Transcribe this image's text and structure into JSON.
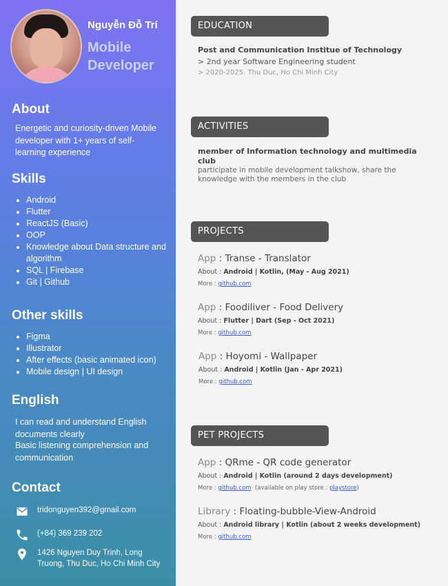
{
  "profile": {
    "name": "Nguyễn Đỗ Trí",
    "role": "Mobile Developer"
  },
  "about": {
    "heading": "About",
    "text": "Energetic and curiosity-driven Mobile developer with 1+ years of self-learning experience"
  },
  "skills": {
    "heading": "Skills",
    "items": [
      "Android",
      "Flutter",
      "ReactJS (Basic)",
      "OOP",
      "Knowledge about Data structure and algorithm",
      "SQL | Firebase",
      "Git | Github"
    ]
  },
  "other_skills": {
    "heading": "Other skills",
    "items": [
      "Figma",
      "Illustrator",
      "After effects (basic animated icon)",
      "Mobile design | UI design"
    ]
  },
  "english": {
    "heading": "English",
    "line1": "I can read and understand English documents clearly",
    "line2": "Basic listening comprehension and communication"
  },
  "contact": {
    "heading": "Contact",
    "email": "tridonguyen392@gmail.com",
    "phone": "(+84) 369 239 202",
    "address": "1426 Nguyen Duy Trinh, Long Truong, Thu Duc, Ho Chi Minh City"
  },
  "education": {
    "heading": "EDUCATION",
    "school": "Post and Communication Institue of Technology",
    "line1": "> 2nd year Software Engineering student",
    "line2": "> 2020-2025. Thu Duc, Ho Chi Minh City"
  },
  "activities": {
    "heading": "ACTIVITIES",
    "title": "member of Information technology and multimedia club",
    "desc": "participate in mobile development talkshow, share the knowledge with the members in the club"
  },
  "projects": {
    "heading": "PROJECTS",
    "items": [
      {
        "kind": "App",
        "sep": " : ",
        "name": "Transe - Translator",
        "about_label": "About : ",
        "about": "Android | Kotlin, (May - Aug 2021)",
        "more_label": "More : ",
        "link": "github.com"
      },
      {
        "kind": "App",
        "sep": " : ",
        "name": "Foodiliver - Food Delivery",
        "about_label": "About : ",
        "about": "Flutter | Dart (Sep - Oct 2021)",
        "more_label": "More : ",
        "link": "github.com"
      },
      {
        "kind": "App",
        "sep": " : ",
        "name": "Hoyomi - Wallpaper",
        "about_label": "About : ",
        "about": "Android | Kotlin (Jan - Apr 2021)",
        "more_label": "More : ",
        "link": "github.com"
      }
    ]
  },
  "pet_projects": {
    "heading": "PET PROJECTS",
    "items": [
      {
        "kind": "App",
        "sep": " : ",
        "name": "QRme - QR code generator",
        "about_label": "About : ",
        "about": "Android | Kotlin (around 2 days development)",
        "more_label": "More : ",
        "link": "github.com",
        "extra_pre": "(available on play store : ",
        "extra_link": "playstore",
        "extra_post": ")"
      },
      {
        "kind": "Library",
        "sep": " : ",
        "name": "Floating-bubble-View-Android",
        "about_label": "About : ",
        "about": "Android library | Kotlin (about 2 weeks development)",
        "more_label": "More : ",
        "link": "github.com"
      }
    ]
  },
  "colors": {
    "sidebar_top": "#7f72f3",
    "sidebar_bottom": "#3a8fa6",
    "header_bg": "#555555",
    "link": "#3b5ed8"
  },
  "icons": [
    "email-icon",
    "phone-icon",
    "location-icon"
  ]
}
